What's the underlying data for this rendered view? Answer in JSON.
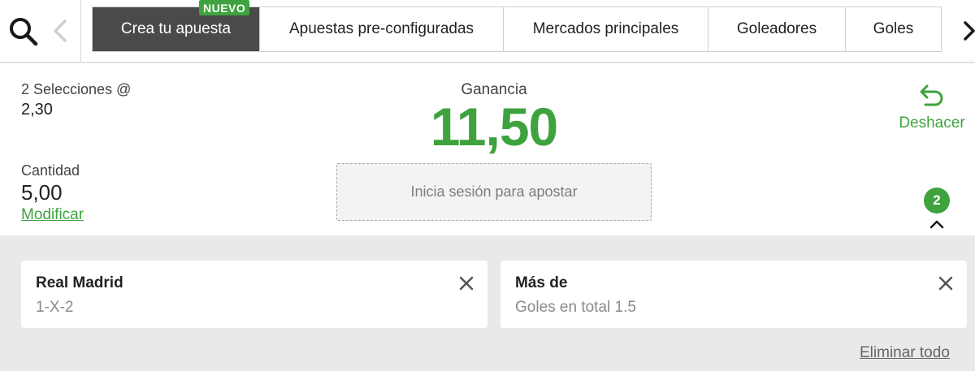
{
  "nav": {
    "tabs": [
      {
        "label": "Crea tu apuesta",
        "badge": "NUEVO"
      },
      {
        "label": "Apuestas pre-configuradas"
      },
      {
        "label": "Mercados principales"
      },
      {
        "label": "Goleadores"
      },
      {
        "label": "Goles"
      }
    ],
    "icons": {
      "search": "search-icon",
      "prev": "chevron-left-icon",
      "next": "chevron-right-icon"
    }
  },
  "slip": {
    "selections_text": "2 Selecciones @",
    "odds": "2,30",
    "gain_label": "Ganancia",
    "gain_value": "11,50",
    "undo_label": "Deshacer",
    "stake_label": "Cantidad",
    "stake_value": "5,00",
    "modify_label": "Modificar",
    "login_label": "Inicia sesión para apostar",
    "count_badge": "2"
  },
  "selections": [
    {
      "title": "Real Madrid",
      "subtitle": "1-X-2"
    },
    {
      "title": "Más de",
      "subtitle": "Goles en total 1.5"
    }
  ],
  "remove_all_label": "Eliminar todo",
  "colors": {
    "accent": "#3ea33e",
    "active_tab": "#4a4a4a",
    "panel_bg": "#e9e9e9"
  }
}
